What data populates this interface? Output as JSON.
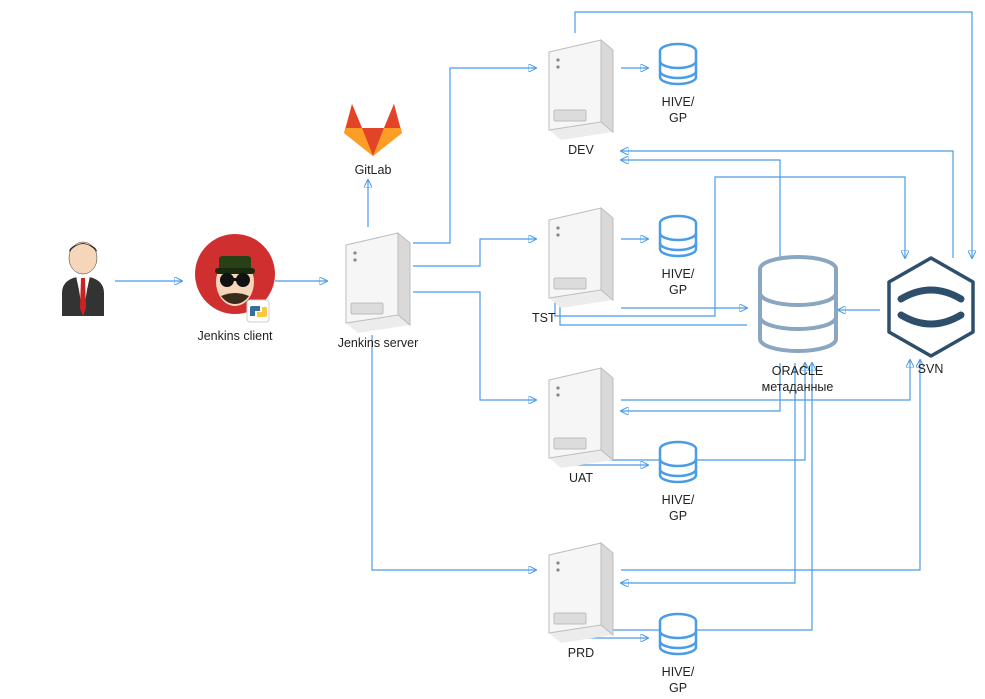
{
  "nodes": {
    "user": {
      "label": ""
    },
    "jenkinsClient": {
      "label": "Jenkins client"
    },
    "jenkinsServer": {
      "label": "Jenkins server"
    },
    "gitlab": {
      "label": "GitLab"
    },
    "dev": {
      "label": "DEV"
    },
    "tst": {
      "label": "TST"
    },
    "uat": {
      "label": "UAT"
    },
    "prd": {
      "label": "PRD"
    },
    "hiveDev": {
      "label": "HIVE/\nGP"
    },
    "hiveTst": {
      "label": "HIVE/\nGP"
    },
    "hiveUat": {
      "label": "HIVE/\nGP"
    },
    "hivePrd": {
      "label": "HIVE/\nGP"
    },
    "oracle": {
      "label": "ORACLE\nметаданные"
    },
    "svn": {
      "label": "SVN"
    }
  },
  "colors": {
    "arrow": "#4a9be8",
    "serverFill": "#f4f4f4",
    "serverStroke": "#bdbdbd",
    "dbStroke": "#4a9be8",
    "oracleStroke": "#8aa6c1",
    "svnStroke": "#2e4f6b",
    "gitlabOrange": "#fc6d26",
    "gitlabDark": "#e24329"
  }
}
